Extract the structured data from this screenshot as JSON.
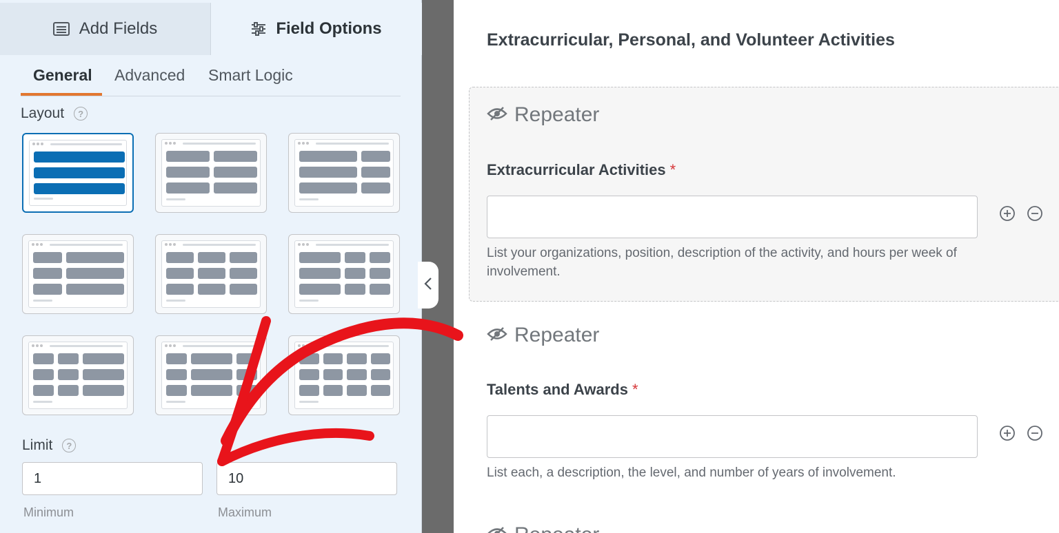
{
  "left_panel": {
    "tabs": [
      {
        "label": "Add Fields",
        "icon": "list-icon",
        "active": false
      },
      {
        "label": "Field Options",
        "icon": "sliders-icon",
        "active": true
      }
    ],
    "sub_tabs": [
      {
        "label": "General",
        "active": true
      },
      {
        "label": "Advanced",
        "active": false
      },
      {
        "label": "Smart Logic",
        "active": false
      }
    ],
    "layout_label": "Layout",
    "layout_options_selected": 1,
    "limit_label": "Limit",
    "limit": {
      "minimum_value": "1",
      "maximum_value": "10",
      "minimum_caption": "Minimum",
      "maximum_caption": "Maximum"
    }
  },
  "form": {
    "section_title": "Extracurricular, Personal, and Volunteer Activities",
    "repeaters": [
      {
        "title": "Repeater",
        "field_label": "Extracurricular Activities",
        "required_mark": "*",
        "description": "List your organizations, position, description of the activity, and hours per week of involvement."
      },
      {
        "title": "Repeater",
        "field_label": "Talents and Awards",
        "required_mark": "*",
        "description": "List each, a description, the level, and number of years of involvement."
      },
      {
        "title": "Repeater"
      }
    ]
  },
  "colors": {
    "accent_orange": "#e27730",
    "selected_blue": "#0b6eb4",
    "annotation_red": "#e8141b",
    "required_red": "#d63638"
  }
}
